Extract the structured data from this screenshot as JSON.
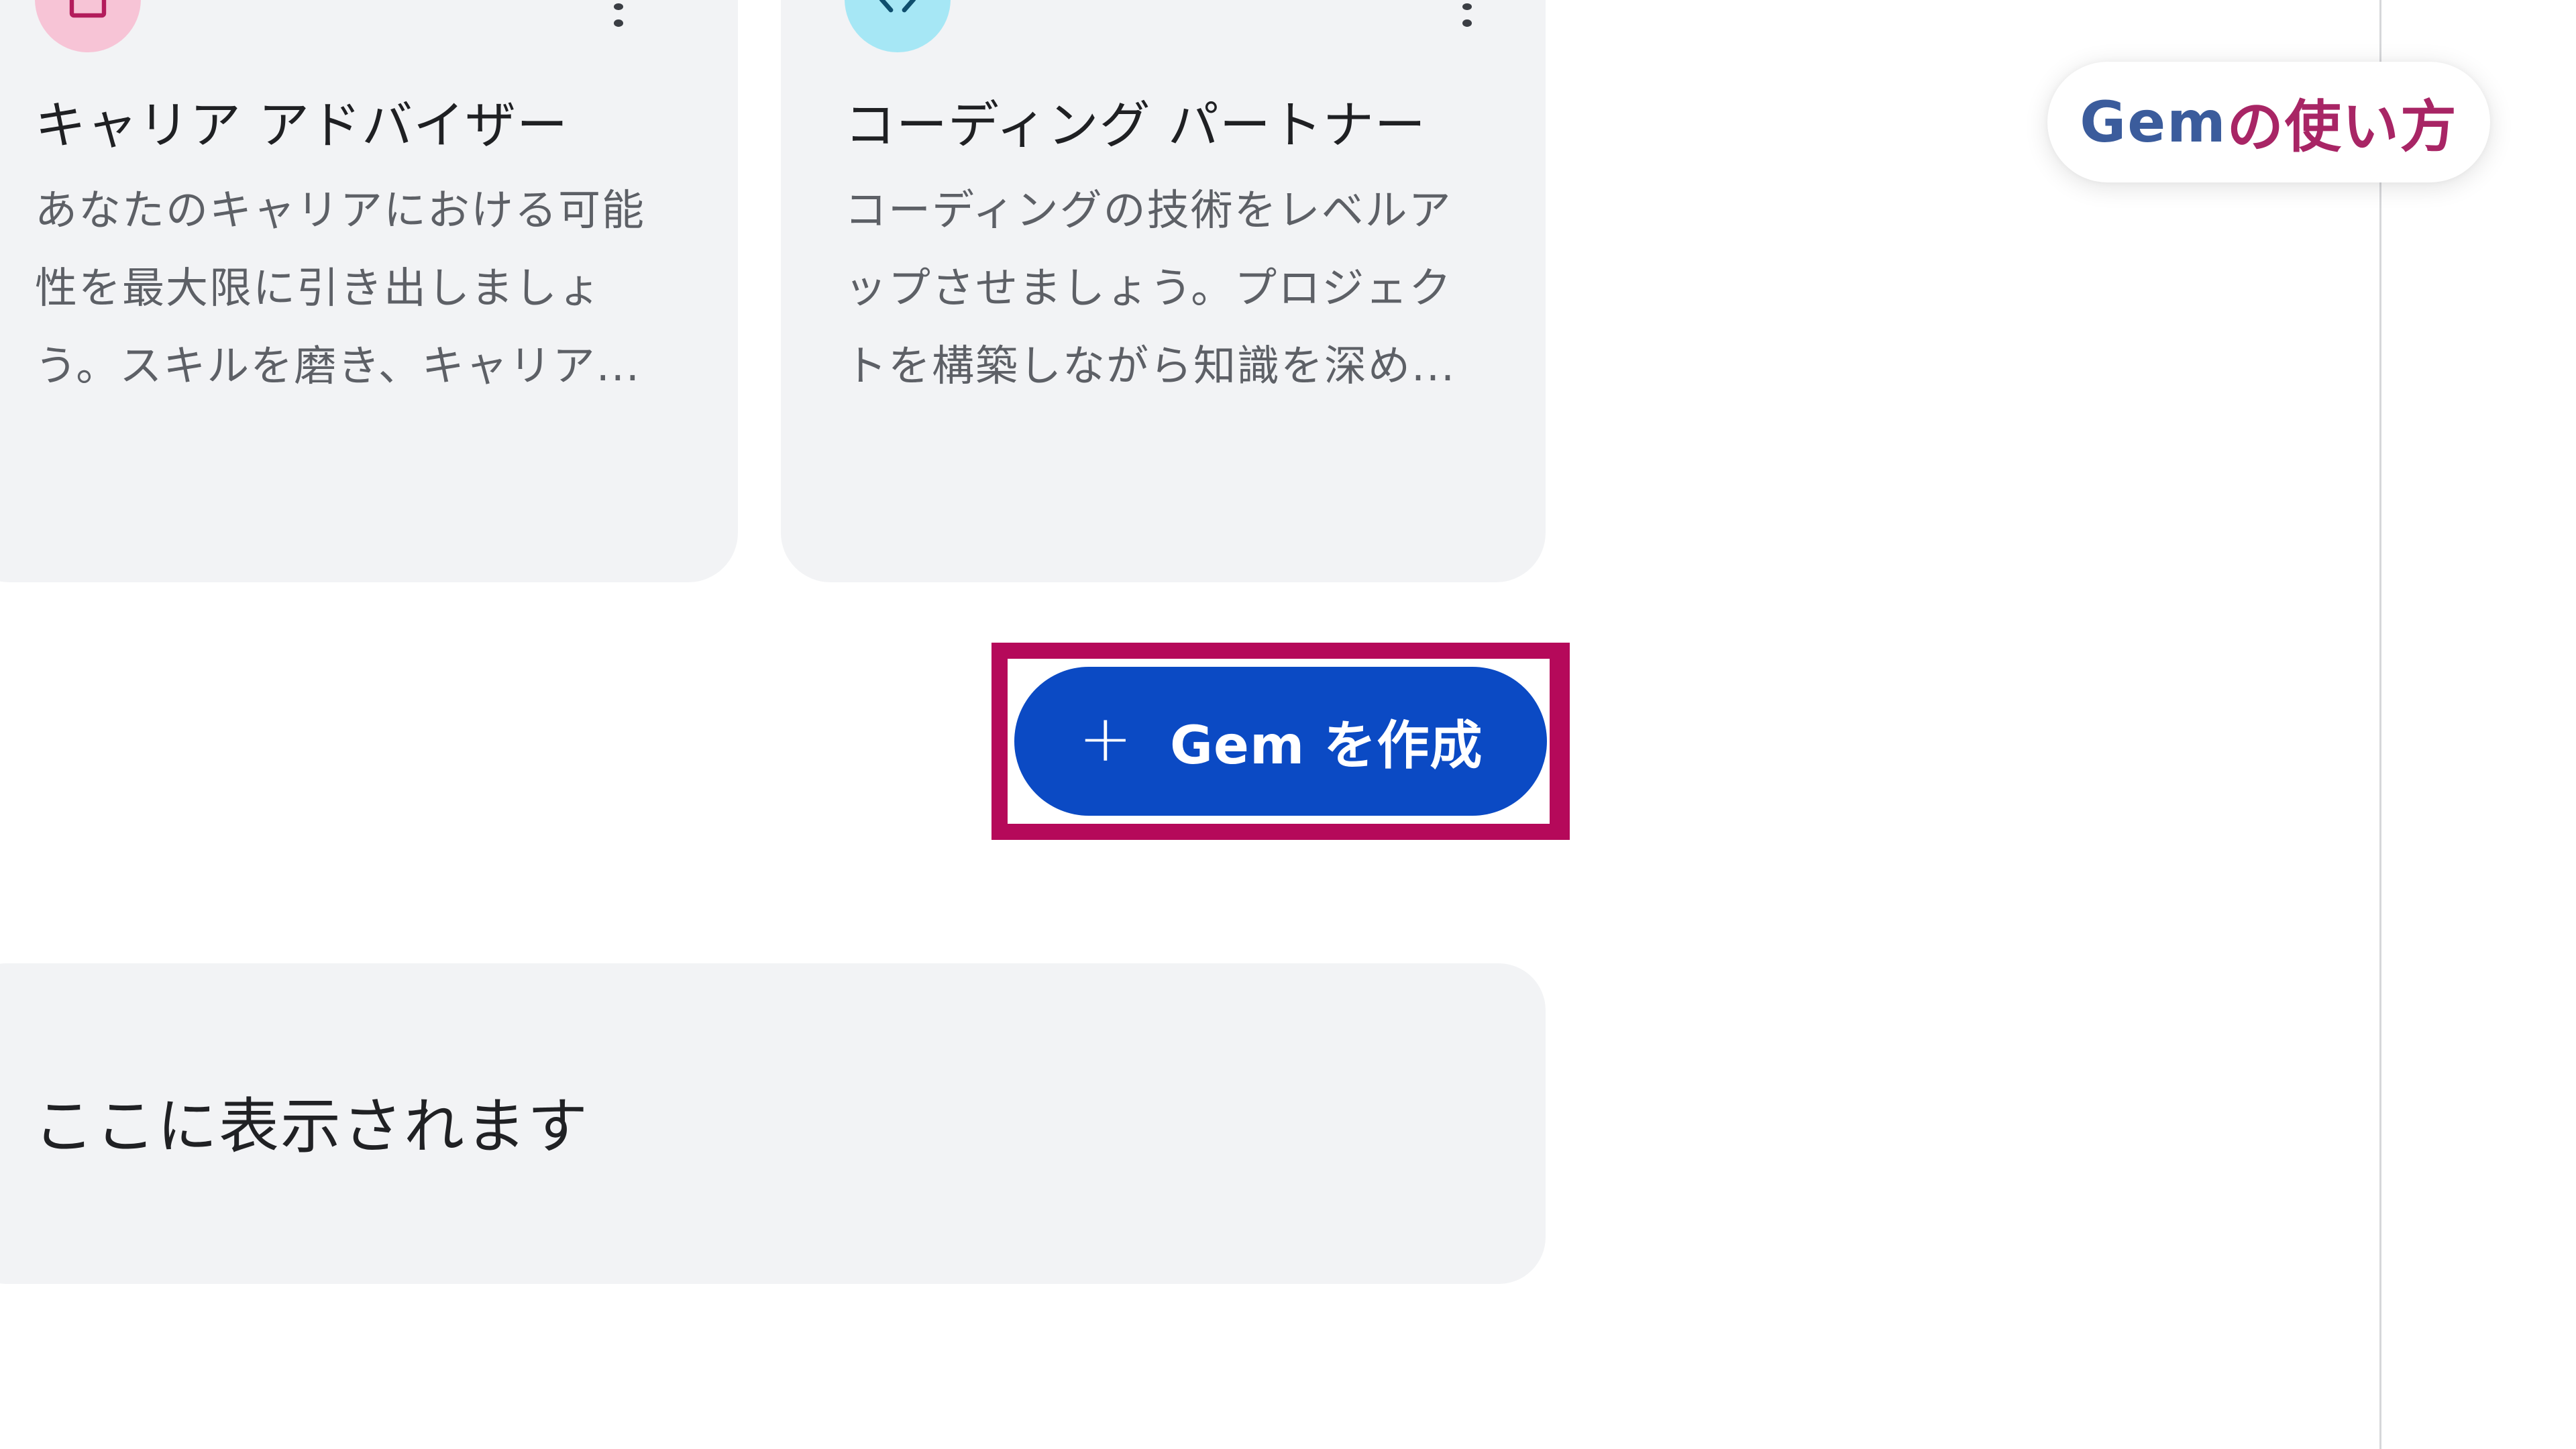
{
  "cards": [
    {
      "title": "キャリア アドバイザー",
      "description_lines": [
        "あなたのキャリアにおける可能",
        "性を最大限に引き出しましょ",
        "う。スキルを磨き、キャリア..."
      ],
      "icon": "briefcase-icon",
      "icon_bg": "#f7c4d6"
    },
    {
      "title": "コーディング パートナー",
      "description_lines": [
        "コーディングの技術をレベルア",
        "ップさせましょう。プロジェク",
        "トを構築しながら知識を深め..."
      ],
      "icon": "code-icon",
      "icon_bg": "#a6e7f5"
    }
  ],
  "create_button": {
    "icon": "plus-icon",
    "icon_glyph": "+",
    "label": "Gem を作成",
    "color": "#0b4ac4",
    "highlight_color": "#b5095a"
  },
  "empty_panel": {
    "text": "ここに表示されます"
  },
  "howto": {
    "label_gem": "Gem",
    "label_rest": "の使い方",
    "color_gem": "#3b5c9c",
    "color_rest": "#a82565"
  }
}
